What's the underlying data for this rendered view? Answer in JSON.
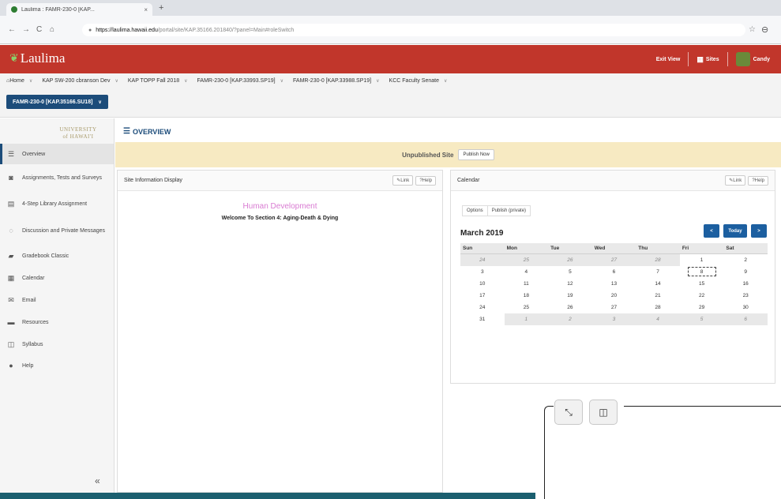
{
  "browser": {
    "tab_title": "Laulima : FAMR-230-0 [KAP...",
    "tab_close": "×",
    "new_tab": "+",
    "url_host": "https://laulima.hawaii.edu",
    "url_path": "/portal/site/KAP.35166.201840/?panel=Main#roleSwitch",
    "nav_back": "←",
    "nav_forward": "→",
    "nav_reload": "C",
    "nav_home": "⌂",
    "lock": "🔒",
    "star": "☆",
    "profile": "⊖"
  },
  "header": {
    "logo_text": "Laulima",
    "exit_view": "Exit View",
    "sites": "Sites",
    "user": "Candy"
  },
  "site_nav": {
    "sites": [
      "Home",
      "KAP SW-200 cbranson Dev",
      "KAP TOPP Fall 2018",
      "FAMR-230-0 [KAP.33993.SP19]",
      "FAMR-230-0 [KAP.33988.SP19]",
      "KCC Faculty Senate"
    ],
    "current_site": "FAMR-230-0 [KAP.35166.SU18]"
  },
  "sidebar": {
    "logo_line1": "UNIVERSITY",
    "logo_line2": "of HAWAI'I",
    "items": [
      {
        "label": "Overview",
        "icon": "☰"
      },
      {
        "label": "Assignments, Tests and Surveys",
        "icon": "◙"
      },
      {
        "label": "4-Step Library Assignment",
        "icon": "▤"
      },
      {
        "label": "Discussion and Private Messages",
        "icon": "◌"
      },
      {
        "label": "Gradebook Classic",
        "icon": "▰"
      },
      {
        "label": "Calendar",
        "icon": "▦"
      },
      {
        "label": "Email",
        "icon": "✉"
      },
      {
        "label": "Resources",
        "icon": "▬"
      },
      {
        "label": "Syllabus",
        "icon": "◫"
      },
      {
        "label": "Help",
        "icon": "●"
      }
    ],
    "collapse": "«"
  },
  "main": {
    "title": "OVERVIEW",
    "unpublished_text": "Unpublished Site",
    "publish_now": "Publish Now"
  },
  "site_info": {
    "title": "Site Information Display",
    "link": "Link",
    "help": "Help",
    "site_title": "Human Development",
    "welcome": "Welcome To Section 4: Aging-Death & Dying"
  },
  "calendar": {
    "title": "Calendar",
    "link": "Link",
    "help": "Help",
    "tab_options": "Options",
    "tab_publish": "Publish (private)",
    "month": "March 2019",
    "prev": "<",
    "today": "Today",
    "next": ">",
    "days": [
      "Sun",
      "Mon",
      "Tue",
      "Wed",
      "Thu",
      "Fri",
      "Sat"
    ],
    "weeks": [
      [
        {
          "d": "24",
          "o": true
        },
        {
          "d": "25",
          "o": true
        },
        {
          "d": "26",
          "o": true
        },
        {
          "d": "27",
          "o": true
        },
        {
          "d": "28",
          "o": true
        },
        {
          "d": "1"
        },
        {
          "d": "2"
        }
      ],
      [
        {
          "d": "3"
        },
        {
          "d": "4"
        },
        {
          "d": "5"
        },
        {
          "d": "6"
        },
        {
          "d": "7"
        },
        {
          "d": "8",
          "t": true
        },
        {
          "d": "9"
        }
      ],
      [
        {
          "d": "10"
        },
        {
          "d": "11"
        },
        {
          "d": "12"
        },
        {
          "d": "13"
        },
        {
          "d": "14"
        },
        {
          "d": "15"
        },
        {
          "d": "16"
        }
      ],
      [
        {
          "d": "17"
        },
        {
          "d": "18"
        },
        {
          "d": "19"
        },
        {
          "d": "20"
        },
        {
          "d": "21"
        },
        {
          "d": "22"
        },
        {
          "d": "23"
        }
      ],
      [
        {
          "d": "24"
        },
        {
          "d": "25"
        },
        {
          "d": "26"
        },
        {
          "d": "27"
        },
        {
          "d": "28"
        },
        {
          "d": "29"
        },
        {
          "d": "30"
        }
      ],
      [
        {
          "d": "31"
        },
        {
          "d": "1",
          "o": true
        },
        {
          "d": "2",
          "o": true
        },
        {
          "d": "3",
          "o": true
        },
        {
          "d": "4",
          "o": true
        },
        {
          "d": "5",
          "o": true
        },
        {
          "d": "6",
          "o": true
        }
      ]
    ]
  },
  "overlay": {
    "minimize_icon": "⤡",
    "split_icon": "◫"
  }
}
